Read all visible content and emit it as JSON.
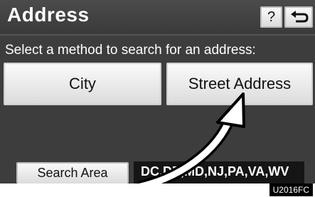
{
  "header": {
    "title": "Address",
    "help_label": "?"
  },
  "instruction": "Select a method to search for an address:",
  "buttons": {
    "city": "City",
    "street_address": "Street Address",
    "search_area": "Search Area"
  },
  "search_area_value": "DC,DE,MD,NJ,PA,VA,WV",
  "figure_code": "U2016FC",
  "icons": {
    "back": "back-arrow-icon",
    "pointer": "curved-arrow-icon"
  }
}
